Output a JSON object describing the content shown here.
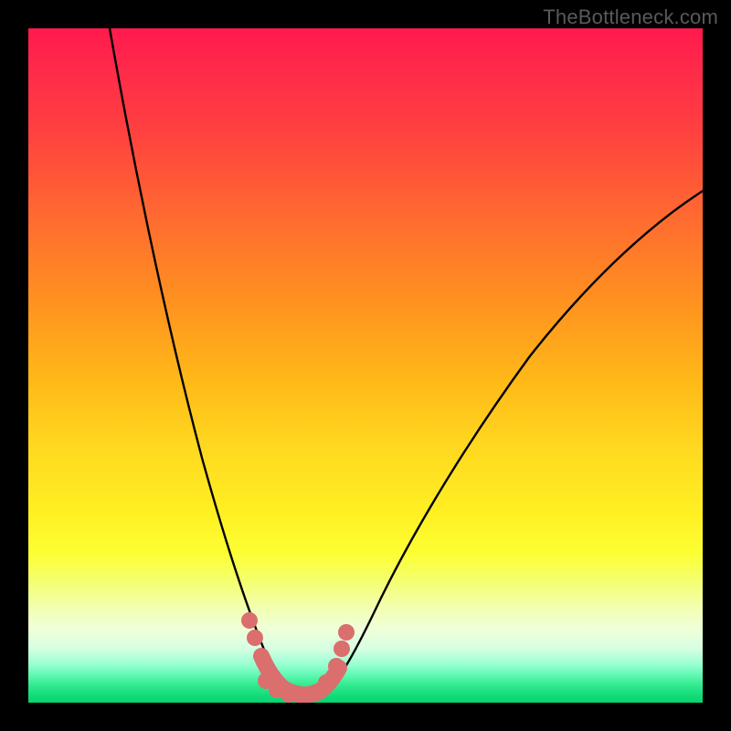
{
  "watermark": "TheBottleneck.com",
  "chart_data": {
    "type": "line",
    "title": "",
    "xlabel": "",
    "ylabel": "",
    "xlim": [
      0,
      100
    ],
    "ylim": [
      0,
      100
    ],
    "series": [
      {
        "name": "left-curve",
        "x": [
          12,
          14,
          16,
          18,
          20,
          22,
          24,
          26,
          28,
          30,
          32,
          33.5,
          35,
          36.5,
          38
        ],
        "y": [
          100,
          91,
          82,
          73,
          64,
          55,
          46,
          37,
          29,
          21,
          14,
          9,
          5,
          2,
          0.5
        ]
      },
      {
        "name": "right-curve",
        "x": [
          44,
          46,
          48,
          50,
          53,
          57,
          62,
          68,
          75,
          83,
          92,
          100
        ],
        "y": [
          0.5,
          3,
          7,
          12,
          18,
          25,
          33,
          42,
          51,
          60,
          69,
          76
        ]
      },
      {
        "name": "markers",
        "type": "scatter",
        "points": [
          {
            "x": 32.8,
            "y": 12.2
          },
          {
            "x": 33.6,
            "y": 9.6
          },
          {
            "x": 35.3,
            "y": 3.2
          },
          {
            "x": 36.8,
            "y": 1.9
          },
          {
            "x": 38.6,
            "y": 1.2
          },
          {
            "x": 40.4,
            "y": 1.0
          },
          {
            "x": 42.5,
            "y": 1.4
          },
          {
            "x": 44.2,
            "y": 2.9
          },
          {
            "x": 45.6,
            "y": 5.4
          },
          {
            "x": 46.4,
            "y": 8.0
          },
          {
            "x": 47.2,
            "y": 10.4
          }
        ]
      }
    ],
    "gradient_bands": [
      "#ff1a4d",
      "#ff6a30",
      "#ffb818",
      "#fff022",
      "#f2ffb2",
      "#93ffd0",
      "#11db78"
    ]
  }
}
